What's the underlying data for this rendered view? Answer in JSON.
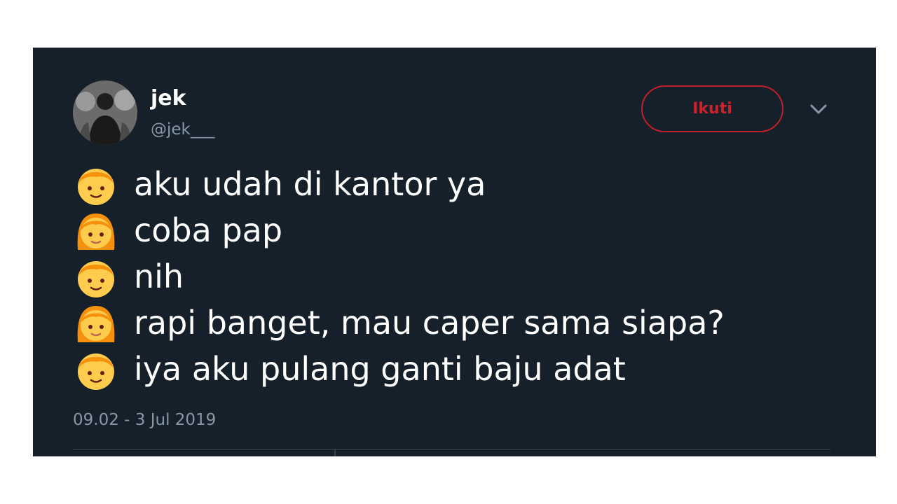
{
  "tweet": {
    "display_name": "jek",
    "handle": "@jek___",
    "follow_label": "Ikuti",
    "lines": [
      {
        "speaker": "boy-emoji",
        "text": "aku udah di kantor ya"
      },
      {
        "speaker": "girl-emoji",
        "text": "coba pap"
      },
      {
        "speaker": "boy-emoji",
        "text": "nih"
      },
      {
        "speaker": "girl-emoji",
        "text": "rapi banget, mau caper sama siapa?"
      },
      {
        "speaker": "boy-emoji",
        "text": "iya aku pulang ganti baju adat"
      }
    ],
    "timestamp": "09.02 - 3 Jul 2019"
  },
  "colors": {
    "card_background": "#15202b",
    "follow_accent": "#c0202a",
    "muted_text": "#8899a6",
    "emoji_skin": "#ffcc4d",
    "emoji_hair": "#f4900c"
  },
  "icons": {
    "menu": "chevron-down-icon",
    "avatar": "profile-photo"
  }
}
